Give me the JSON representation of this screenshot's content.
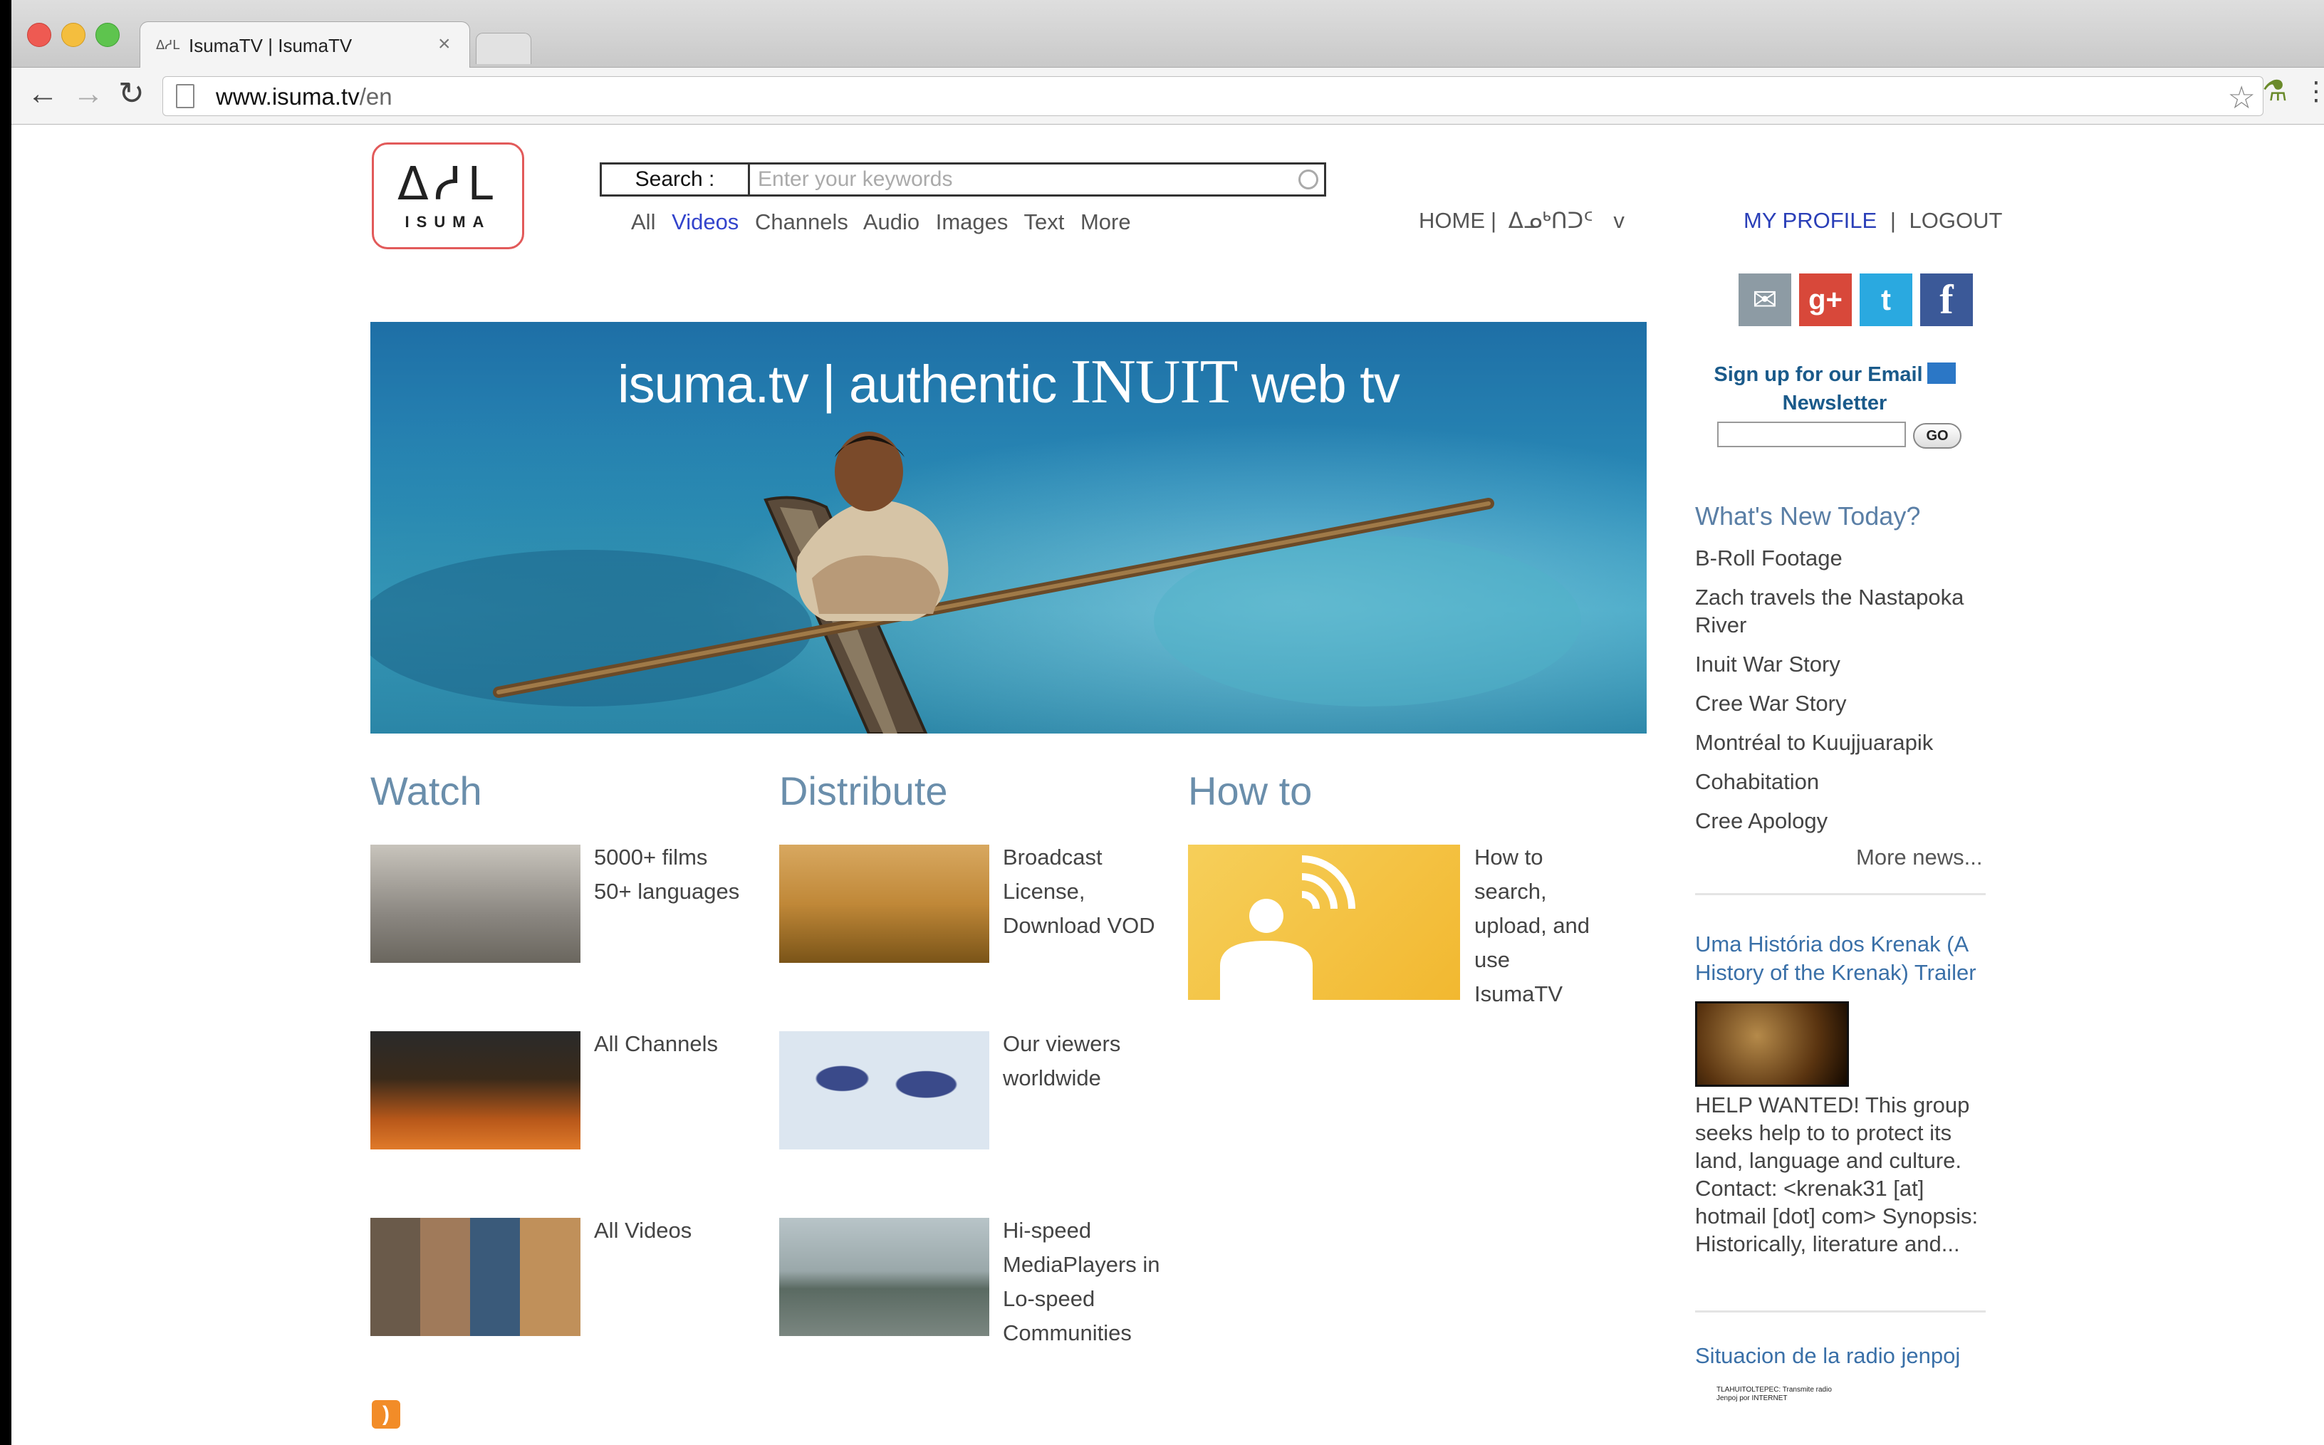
{
  "browser": {
    "tab_title": "IsumaTV | IsumaTV",
    "tab_favicon": "ᐃᓱᒪ",
    "url_host": "www.isuma.tv",
    "url_path": "/en"
  },
  "header": {
    "logo_syllabics": "ᐃᓱᒪ",
    "logo_word": "ISUMA",
    "search_label": "Search :",
    "search_placeholder": "Enter your keywords",
    "filters": [
      "All",
      "Videos",
      "Channels",
      "Audio",
      "Images",
      "Text",
      "More"
    ],
    "active_filter": "Videos",
    "nav_home": "HOME",
    "nav_language": "ᐃᓄᒃᑎᑐᑦ",
    "nav_language_caret": "v",
    "my_profile": "MY PROFILE",
    "logout": "LOGOUT"
  },
  "social": {
    "email_icon": "✉",
    "gplus_label": "g+",
    "twitter_icon": "t",
    "facebook_label": "f",
    "colors": {
      "email": "#8d9ba4",
      "gplus": "#d8483a",
      "twitter": "#2aa9e0",
      "facebook": "#3b5998"
    }
  },
  "newsletter": {
    "title_line1": "Sign up for our Email",
    "title_line2": "Newsletter",
    "button": "GO"
  },
  "hero": {
    "title_part1": "isuma.tv | authentic ",
    "title_big": "INUIT",
    "title_part2": " web tv"
  },
  "sections": {
    "watch": {
      "title": "Watch",
      "items": [
        {
          "text": "5000+ films\n50+ languages"
        },
        {
          "text": "All Channels"
        },
        {
          "text": "All Videos"
        }
      ]
    },
    "distribute": {
      "title": "Distribute",
      "items": [
        {
          "text": "Broadcast\nLicense,\nDownload VOD"
        },
        {
          "text": "Our viewers\nworldwide"
        },
        {
          "text": "Hi-speed\nMediaPlayers in\nLo-speed\nCommunities"
        }
      ]
    },
    "howto": {
      "title": "How to",
      "items": [
        {
          "text": "How to\nsearch,\nupload, and\nuse\nIsumaTV"
        }
      ]
    }
  },
  "sidebar": {
    "whats_new_title": "What's New Today?",
    "whats_new": [
      "B-Roll Footage",
      "Zach travels the Nastapoka River",
      "Inuit War Story",
      "Cree War Story",
      "Montréal to Kuujjuarapik",
      "Cohabitation",
      "Cree Apology"
    ],
    "more_news": "More news...",
    "feature1_title": "Uma História dos Krenak (A History of the Krenak) Trailer",
    "feature1_text": "HELP WANTED! This group seeks help to to protect its land, language and culture. Contact: <krenak31 [at] hotmail [dot] com> Synopsis: Historically, literature and...",
    "feature2_title": "Situacion de la radio jenpoj",
    "feature2_thumb_text": "TLAHUITOLTEPEC: Transmite radio Jenpoj por INTERNET"
  }
}
